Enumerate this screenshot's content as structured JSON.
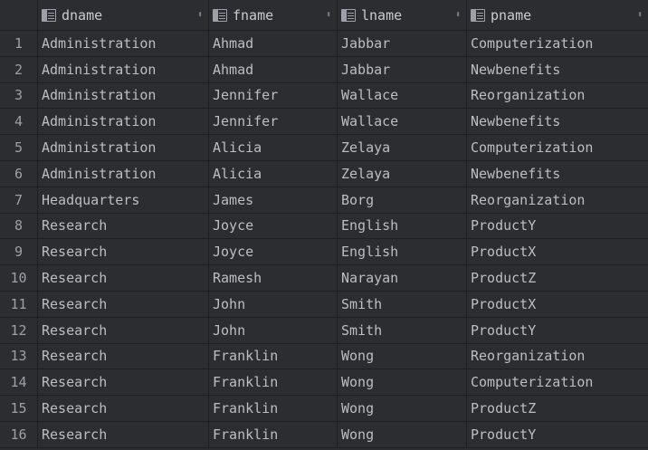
{
  "columns": [
    {
      "label": "dname"
    },
    {
      "label": "fname"
    },
    {
      "label": "lname"
    },
    {
      "label": "pname"
    }
  ],
  "rows": [
    {
      "num": "1",
      "dname": "Administration",
      "fname": "Ahmad",
      "lname": "Jabbar",
      "pname": "Computerization"
    },
    {
      "num": "2",
      "dname": "Administration",
      "fname": "Ahmad",
      "lname": "Jabbar",
      "pname": "Newbenefits"
    },
    {
      "num": "3",
      "dname": "Administration",
      "fname": "Jennifer",
      "lname": "Wallace",
      "pname": "Reorganization"
    },
    {
      "num": "4",
      "dname": "Administration",
      "fname": "Jennifer",
      "lname": "Wallace",
      "pname": "Newbenefits"
    },
    {
      "num": "5",
      "dname": "Administration",
      "fname": "Alicia",
      "lname": "Zelaya",
      "pname": "Computerization"
    },
    {
      "num": "6",
      "dname": "Administration",
      "fname": "Alicia",
      "lname": "Zelaya",
      "pname": "Newbenefits"
    },
    {
      "num": "7",
      "dname": "Headquarters",
      "fname": "James",
      "lname": "Borg",
      "pname": "Reorganization"
    },
    {
      "num": "8",
      "dname": "Research",
      "fname": "Joyce",
      "lname": "English",
      "pname": "ProductY"
    },
    {
      "num": "9",
      "dname": "Research",
      "fname": "Joyce",
      "lname": "English",
      "pname": "ProductX"
    },
    {
      "num": "10",
      "dname": "Research",
      "fname": "Ramesh",
      "lname": "Narayan",
      "pname": "ProductZ"
    },
    {
      "num": "11",
      "dname": "Research",
      "fname": "John",
      "lname": "Smith",
      "pname": "ProductX"
    },
    {
      "num": "12",
      "dname": "Research",
      "fname": "John",
      "lname": "Smith",
      "pname": "ProductY"
    },
    {
      "num": "13",
      "dname": "Research",
      "fname": "Franklin",
      "lname": "Wong",
      "pname": "Reorganization"
    },
    {
      "num": "14",
      "dname": "Research",
      "fname": "Franklin",
      "lname": "Wong",
      "pname": "Computerization"
    },
    {
      "num": "15",
      "dname": "Research",
      "fname": "Franklin",
      "lname": "Wong",
      "pname": "ProductZ"
    },
    {
      "num": "16",
      "dname": "Research",
      "fname": "Franklin",
      "lname": "Wong",
      "pname": "ProductY"
    }
  ],
  "icons": {
    "column": "table-column-icon",
    "sort": "sort-arrows-icon"
  },
  "colors": {
    "background": "#2b2d30",
    "grid_line": "#1e1f22",
    "text": "#bcbec4"
  }
}
